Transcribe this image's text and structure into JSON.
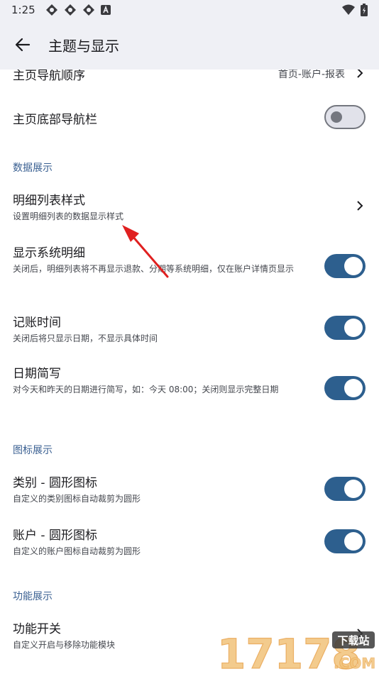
{
  "status": {
    "time": "1:25"
  },
  "appbar": {
    "title": "主题与显示"
  },
  "items": {
    "nav_order": {
      "label": "主页导航顺序",
      "value": "首页-账户-报表"
    },
    "bottom_nav": {
      "label": "主页底部导航栏",
      "enabled": false
    },
    "section_data": "数据展示",
    "detail_style": {
      "label": "明细列表样式",
      "sub": "设置明细列表的数据显示样式"
    },
    "show_system": {
      "label": "显示系统明细",
      "sub": "关闭后，明细列表将不再显示退款、分期等系统明细，仅在账户详情页显示",
      "enabled": true
    },
    "record_time": {
      "label": "记账时间",
      "sub": "关闭后将只显示日期，不显示具体时间",
      "enabled": true
    },
    "date_short": {
      "label": "日期简写",
      "sub": "对今天和昨天的日期进行简写，如：今天 08:00；关闭则显示完整日期",
      "enabled": true
    },
    "section_icon": "图标展示",
    "category_round": {
      "label": "类别 - 圆形图标",
      "sub": "自定义的类别图标自动裁剪为圆形",
      "enabled": true
    },
    "account_round": {
      "label": "账户 - 圆形图标",
      "sub": "自定义的账户图标自动裁剪为圆形",
      "enabled": true
    },
    "section_func": "功能展示",
    "func_switch": {
      "label": "功能开关",
      "sub": "自定义开启与移除功能模块"
    }
  },
  "watermark": {
    "text": "17178",
    "badge": "下载站",
    "suffix": ".COM"
  },
  "colors": {
    "accent": "#2d5f8e",
    "section": "#395f91",
    "bar": "#eff0f5",
    "arrow": "#e02020"
  }
}
